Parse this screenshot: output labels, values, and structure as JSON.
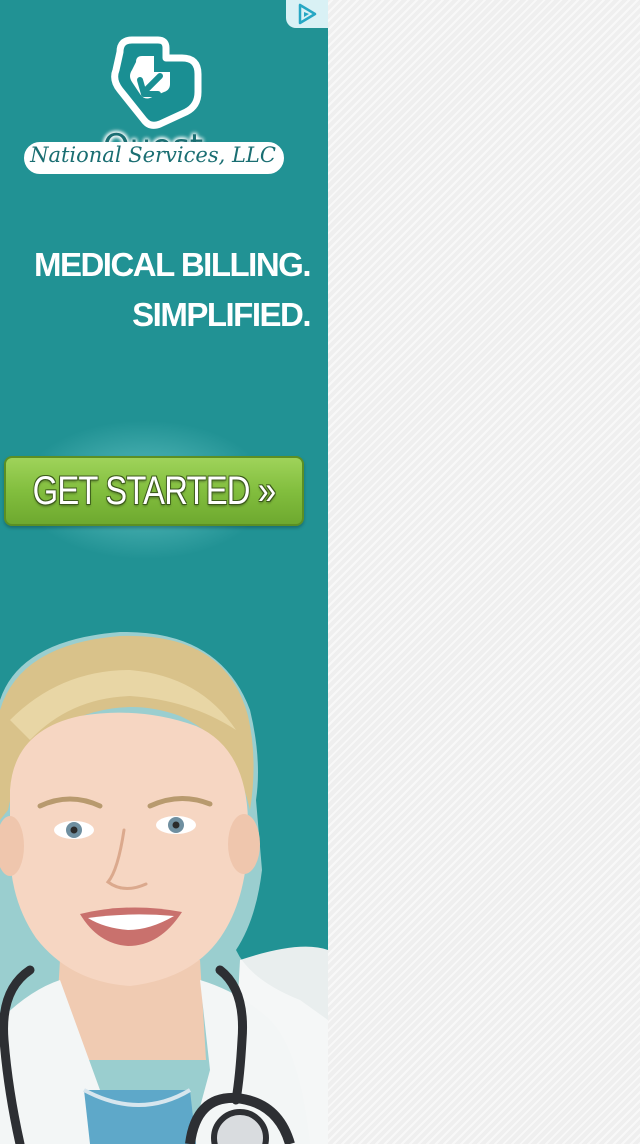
{
  "ad": {
    "logo": {
      "name": "Quest",
      "subtitle": "National Services, LLC"
    },
    "headline": {
      "line1": "MEDICAL BILLING.",
      "line2": "SIMPLIFIED."
    },
    "cta_label": "GET STARTED »",
    "colors": {
      "background": "#219294",
      "cta_green": "#82be3e",
      "brand_teal": "#1a6e72"
    }
  }
}
